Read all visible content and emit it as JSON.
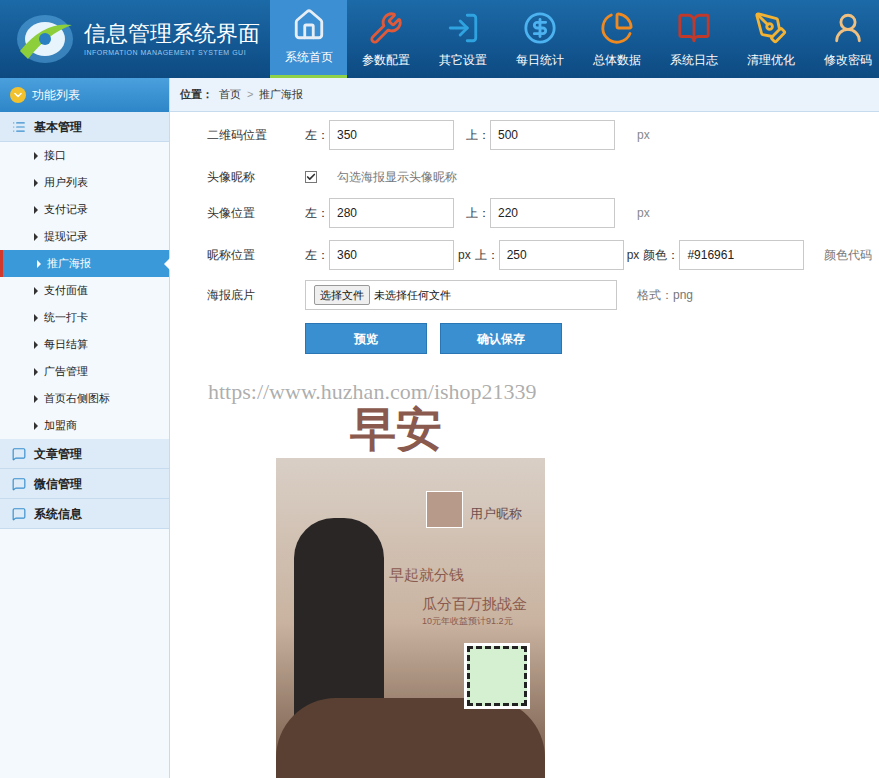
{
  "header": {
    "title": "信息管理系统界面",
    "subtitle": "INFORMATION MANAGEMENT SYSTEM GUI"
  },
  "nav": [
    {
      "label": "系统首页",
      "selected": true
    },
    {
      "label": "参数配置",
      "selected": false
    },
    {
      "label": "其它设置",
      "selected": false
    },
    {
      "label": "每日统计",
      "selected": false
    },
    {
      "label": "总体数据",
      "selected": false
    },
    {
      "label": "系统日志",
      "selected": false
    },
    {
      "label": "清理优化",
      "selected": false
    },
    {
      "label": "修改密码",
      "selected": false
    }
  ],
  "sidebar": {
    "title": "功能列表",
    "sections": [
      {
        "label": "基本管理",
        "expanded": true,
        "items": [
          {
            "label": "接口",
            "selected": false
          },
          {
            "label": "用户列表",
            "selected": false
          },
          {
            "label": "支付记录",
            "selected": false
          },
          {
            "label": "提现记录",
            "selected": false
          },
          {
            "label": "推广海报",
            "selected": true
          },
          {
            "label": "支付面值",
            "selected": false
          },
          {
            "label": "统一打卡",
            "selected": false
          },
          {
            "label": "每日结算",
            "selected": false
          },
          {
            "label": "广告管理",
            "selected": false
          },
          {
            "label": "首页右侧图标",
            "selected": false
          },
          {
            "label": "加盟商",
            "selected": false
          }
        ]
      },
      {
        "label": "文章管理",
        "expanded": false,
        "items": []
      },
      {
        "label": "微信管理",
        "expanded": false,
        "items": []
      },
      {
        "label": "系统信息",
        "expanded": false,
        "items": []
      }
    ]
  },
  "breadcrumb": {
    "prefix": "位置：",
    "items": [
      "首页",
      "推广海报"
    ],
    "separator": ">"
  },
  "form": {
    "qr": {
      "label": "二维码位置",
      "leftLabel": "左：",
      "left": "350",
      "topLabel": "上：",
      "top": "500",
      "unit": "px"
    },
    "avatarNick": {
      "label": "头像昵称",
      "checked": true,
      "hint": "勾选海报显示头像昵称"
    },
    "avatar": {
      "label": "头像位置",
      "leftLabel": "左：",
      "left": "280",
      "topLabel": "上：",
      "top": "220",
      "unit": "px"
    },
    "nick": {
      "label": "昵称位置",
      "leftLabel": "左：",
      "left": "360",
      "unit1": "px",
      "topLabel": "上：",
      "top": "250",
      "unit2": "px",
      "colorLabel": "颜色：",
      "color": "#916961",
      "colorHint": "颜色代码"
    },
    "poster": {
      "label": "海报底片",
      "button": "选择文件",
      "fileText": "未选择任何文件",
      "format": "格式：png"
    },
    "buttons": [
      "预览",
      "确认保存"
    ]
  },
  "watermark": "https://www.huzhan.com/ishop21339",
  "preview": {
    "heading": "早安",
    "nickname": "用户昵称",
    "line1": "早起就分钱",
    "line2": "瓜分百万挑战金",
    "line3": "10元年收益预计91.2元"
  }
}
